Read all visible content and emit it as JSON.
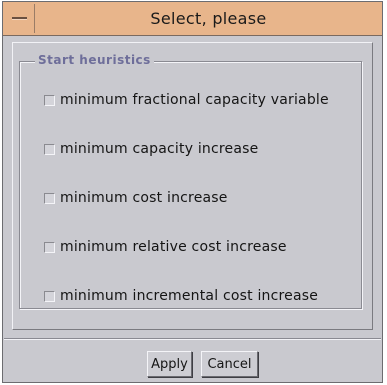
{
  "window": {
    "title": "Select, please"
  },
  "group": {
    "legend": "Start heuristics",
    "options": [
      {
        "label": "minimum fractional capacity variable",
        "checked": false
      },
      {
        "label": "minimum capacity increase",
        "checked": false
      },
      {
        "label": "minimum cost increase",
        "checked": false
      },
      {
        "label": "minimum relative cost increase",
        "checked": false
      },
      {
        "label": "minimum incremental cost increase",
        "checked": false
      }
    ]
  },
  "buttons": {
    "apply_label": "Apply",
    "cancel_label": "Cancel"
  },
  "colors": {
    "titlebar": "#e8b58b",
    "window_bg": "#c9c9cf",
    "legend_text": "#6e6e9a"
  }
}
